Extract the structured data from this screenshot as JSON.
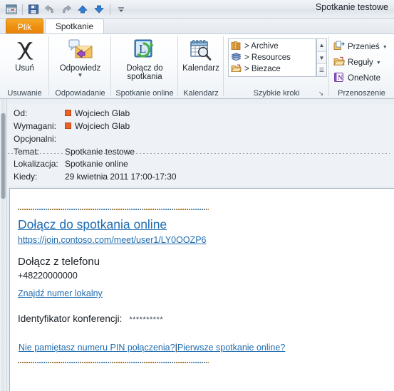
{
  "window": {
    "title": "Spotkanie testowe"
  },
  "quick_access_toolbar": {
    "items": [
      {
        "name": "calendar-icon",
        "label": "Kalendarz"
      },
      {
        "name": "save-icon",
        "label": "Zapisz"
      },
      {
        "name": "undo-icon",
        "label": "Cofnij"
      },
      {
        "name": "redo-icon",
        "label": "Ponów"
      },
      {
        "name": "previous-item-icon",
        "label": "Poprzedni element"
      },
      {
        "name": "next-item-icon",
        "label": "Następny element"
      },
      {
        "name": "customize-qat-icon",
        "label": "Dostosuj pasek narzędzi Szybki dostęp"
      }
    ]
  },
  "tabs": [
    {
      "id": "file",
      "label": "Plik"
    },
    {
      "id": "meeting",
      "label": "Spotkanie"
    }
  ],
  "ribbon": {
    "groups": [
      {
        "id": "usuwanie",
        "label": "Usuwanie",
        "buttons": [
          {
            "label": "Usuń",
            "icon": "delete-x-icon"
          }
        ]
      },
      {
        "id": "odpowiadanie",
        "label": "Odpowiadanie",
        "buttons": [
          {
            "label": "Odpowiedz",
            "icon": "reply-icon",
            "has_dropdown": true
          }
        ]
      },
      {
        "id": "spotkanie-online",
        "label": "Spotkanie online",
        "buttons": [
          {
            "label_line1": "Dołącz do",
            "label_line2": "spotkania",
            "icon": "join-meeting-icon"
          }
        ]
      },
      {
        "id": "kalendarz",
        "label": "Kalendarz",
        "buttons": [
          {
            "label": "Kalendarz",
            "icon": "calendar-search-icon"
          }
        ]
      },
      {
        "id": "szybkie-kroki",
        "label": "Szybkie kroki",
        "quick_steps": [
          {
            "label": "> Archive",
            "icon": "books-icon"
          },
          {
            "label": "> Resources",
            "icon": "book-icon"
          },
          {
            "label": "> Biezace",
            "icon": "folder-icon"
          }
        ],
        "scroll_buttons": [
          {
            "name": "scroll-up-button",
            "glyph": "▲"
          },
          {
            "name": "scroll-down-button",
            "glyph": "▼"
          },
          {
            "name": "more-button",
            "glyph": "☰"
          }
        ],
        "dialog_launcher": "↘"
      },
      {
        "id": "przenoszenie",
        "label": "Przenoszenie",
        "buttons": [
          {
            "label": "Przenieś",
            "icon": "move-icon",
            "has_dropdown": true
          },
          {
            "label": "Reguły",
            "icon": "rules-icon",
            "has_dropdown": true
          },
          {
            "label": "OneNote",
            "icon": "onenote-icon",
            "has_dropdown": false
          }
        ]
      }
    ]
  },
  "header": {
    "fields": [
      {
        "id": "from",
        "label": "Od:",
        "value": "Wojciech Glab",
        "has_presence": true
      },
      {
        "id": "required",
        "label": "Wymagani:",
        "value": "Wojciech Glab",
        "has_presence": true
      },
      {
        "id": "optional",
        "label": "Opcjonalni:",
        "value": "",
        "has_presence": false
      },
      {
        "id": "subject",
        "label": "Temat:",
        "value": "Spotkanie testowe",
        "has_presence": false
      },
      {
        "id": "location",
        "label": "Lokalizacja:",
        "value": "Spotkanie online",
        "has_presence": false
      },
      {
        "id": "when",
        "label": "Kiedy:",
        "value": "29 kwietnia 2011 17:00-17:30",
        "has_presence": false
      }
    ]
  },
  "body": {
    "join_online_heading": "Dołącz do spotkania online",
    "join_online_url": "https://join.contoso.com/meet/user1/LY0OOZP6",
    "join_phone_heading": "Dołącz z telefonu",
    "phone_number": "+48220000000",
    "find_local_number_link": "Znajdź numer lokalny",
    "conference_id_label": "Identyfikator konferencji:",
    "conference_id_value": "**********",
    "forgot_pin_link": "Nie pamiętasz numeru PIN połączenia?",
    "link_separator": "|",
    "first_meeting_link": "Pierwsze spotkanie online?"
  },
  "colors": {
    "file_tab": "#ee8f10",
    "link": "#1f6cb0",
    "presence": "#e8622a",
    "ribbon_bg": "#eef2f6"
  }
}
